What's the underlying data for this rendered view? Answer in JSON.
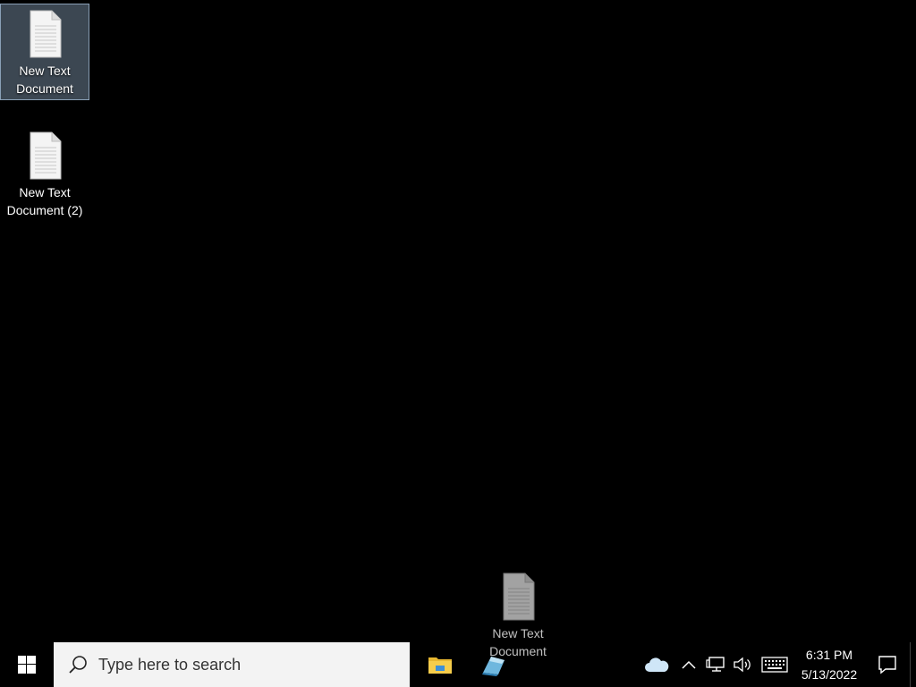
{
  "desktop": {
    "background_color": "#000000",
    "icons": [
      {
        "label": "New Text\nDocument",
        "icon": "text-file-icon",
        "selected": true
      },
      {
        "label": "New Text\nDocument (2)",
        "icon": "text-file-icon",
        "selected": false
      }
    ],
    "drag_ghost": {
      "label": "New Text\nDocument",
      "icon": "text-file-icon"
    }
  },
  "taskbar": {
    "start_icon": "windows-logo-icon",
    "search_placeholder": "Type here to search",
    "pinned": [
      {
        "name": "File Explorer",
        "icon": "folder-icon"
      },
      {
        "name": "App",
        "icon": "app-icon"
      }
    ],
    "tray": {
      "onedrive_icon": "cloud-icon",
      "overflow_icon": "chevron-up-icon",
      "network_icon": "network-icon",
      "volume_icon": "speaker-icon",
      "keyboard_icon": "keyboard-icon",
      "time": "6:31 PM",
      "date": "5/13/2022",
      "notifications_icon": "action-center-icon"
    }
  }
}
